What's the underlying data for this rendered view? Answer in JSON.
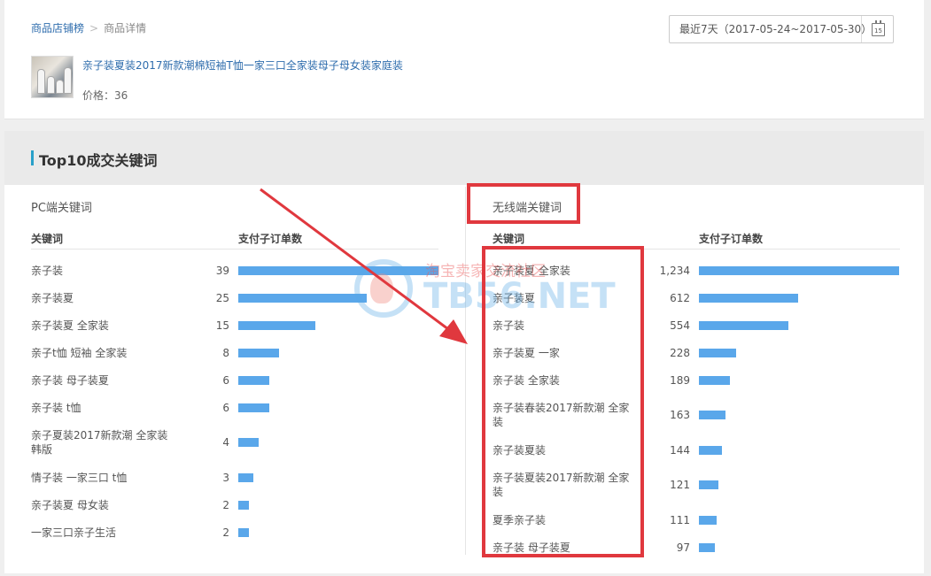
{
  "breadcrumb": {
    "parent": "商品店铺榜",
    "separator": ">",
    "current": "商品详情"
  },
  "product": {
    "title": "亲子装夏装2017新款潮棉短袖T恤一家三口全家装母子母女装家庭装",
    "price_text": "价格：36"
  },
  "date_range": {
    "label": "最近7天（2017-05-24~2017-05-30）",
    "calendar_day": "15"
  },
  "section": {
    "title": "Top10成交关键词"
  },
  "pc": {
    "title": "PC端关键词",
    "col_keyword": "关键词",
    "col_orders": "支付子订单数",
    "rows": [
      {
        "keyword": "亲子装",
        "value": "39",
        "ratio": 1.0
      },
      {
        "keyword": "亲子装夏",
        "value": "25",
        "ratio": 0.641
      },
      {
        "keyword": "亲子装夏 全家装",
        "value": "15",
        "ratio": 0.385
      },
      {
        "keyword": "亲子t恤 短袖 全家装",
        "value": "8",
        "ratio": 0.205
      },
      {
        "keyword": "亲子装 母子装夏",
        "value": "6",
        "ratio": 0.154
      },
      {
        "keyword": "亲子装 t恤",
        "value": "6",
        "ratio": 0.154
      },
      {
        "keyword": "亲子夏装2017新款潮 全家装韩版",
        "value": "4",
        "ratio": 0.103
      },
      {
        "keyword": "情子装 一家三口 t恤",
        "value": "3",
        "ratio": 0.077
      },
      {
        "keyword": "亲子装夏 母女装",
        "value": "2",
        "ratio": 0.051
      },
      {
        "keyword": "一家三口亲子生活",
        "value": "2",
        "ratio": 0.051
      }
    ]
  },
  "mobile": {
    "title": "无线端关键词",
    "col_keyword": "关键词",
    "col_orders": "支付子订单数",
    "rows": [
      {
        "keyword": "亲子装夏 全家装",
        "value": "1,234",
        "ratio": 1.0
      },
      {
        "keyword": "亲子装夏",
        "value": "612",
        "ratio": 0.496
      },
      {
        "keyword": "亲子装",
        "value": "554",
        "ratio": 0.449
      },
      {
        "keyword": "亲子装夏 一家",
        "value": "228",
        "ratio": 0.185
      },
      {
        "keyword": "亲子装 全家装",
        "value": "189",
        "ratio": 0.153
      },
      {
        "keyword": "亲子装春装2017新款潮 全家装",
        "value": "163",
        "ratio": 0.132
      },
      {
        "keyword": "亲子装夏装",
        "value": "144",
        "ratio": 0.117
      },
      {
        "keyword": "亲子装夏装2017新款潮 全家装",
        "value": "121",
        "ratio": 0.098
      },
      {
        "keyword": "夏季亲子装",
        "value": "111",
        "ratio": 0.09
      },
      {
        "keyword": "亲子装 母子装夏",
        "value": "97",
        "ratio": 0.079
      }
    ]
  },
  "watermark": {
    "line1": "淘宝卖家交流社区",
    "line2": "TB56.NET"
  },
  "colors": {
    "bar": "#5aa7ea",
    "link": "#2f6dad",
    "annotation": "#e0383e",
    "accent": "#29a0c9"
  }
}
